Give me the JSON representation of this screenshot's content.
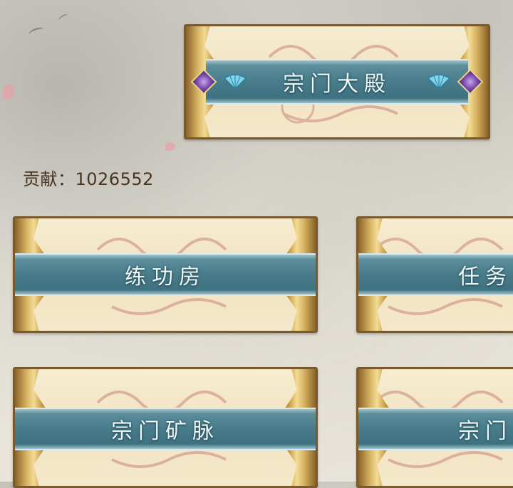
{
  "header": {
    "hall_label": "宗门大殿"
  },
  "contribution": {
    "label": "贡献：",
    "value": "1026552"
  },
  "menu": [
    {
      "label": "练功房"
    },
    {
      "label": "任务"
    },
    {
      "label": "宗门矿脉"
    },
    {
      "label": "宗门"
    }
  ],
  "icons": {
    "gem": "purple-gem-icon",
    "fan": "blue-fan-icon"
  },
  "colors": {
    "band": "#497c8b",
    "label": "#eef7f8",
    "frame": "#7a5a2c",
    "gold": "#d9b565",
    "paper": "#f4e8ca"
  }
}
